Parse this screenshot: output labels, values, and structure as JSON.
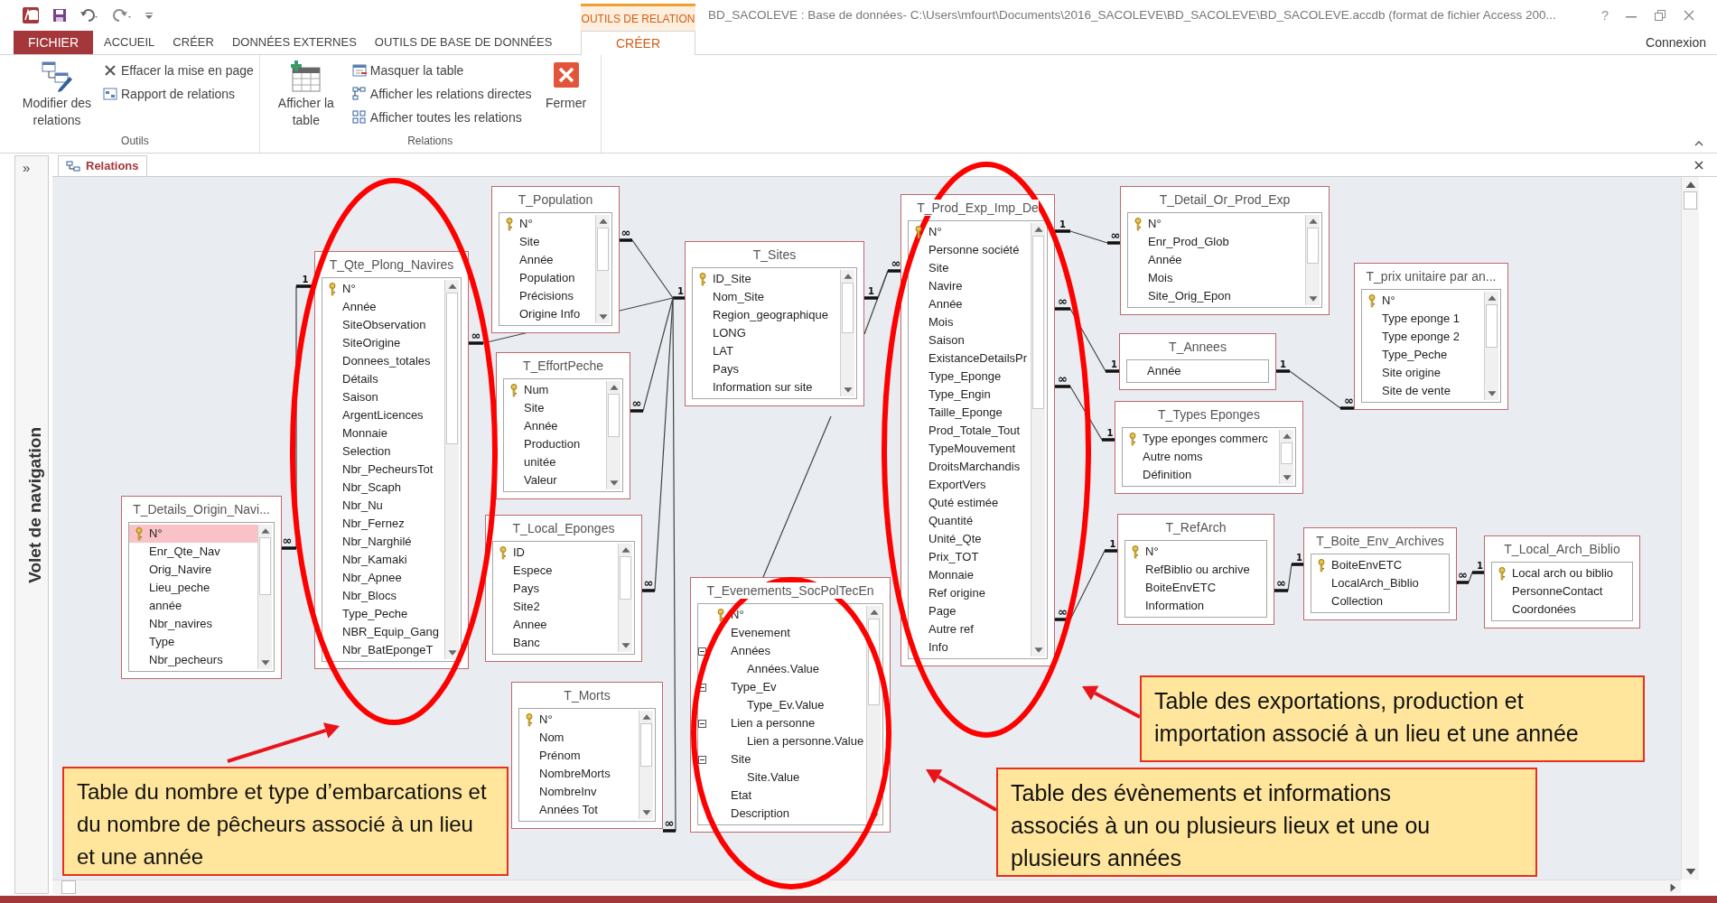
{
  "title_bar": {
    "contextual_group": "OUTILS DE RELATION",
    "title": "BD_SACOLEVE : Base de données- C:\\Users\\mfourt\\Documents\\2016_SACOLEVE\\BD_SACOLEVE\\BD_SACOLEVE.accdb (format de fichier Access 200...",
    "help": "?"
  },
  "ribbon_tabs": [
    {
      "label": "FICHIER",
      "kind": "file",
      "selected": false
    },
    {
      "label": "ACCUEIL",
      "kind": "normal",
      "selected": false
    },
    {
      "label": "CRÉER",
      "kind": "normal",
      "selected": false
    },
    {
      "label": "DONNÉES EXTERNES",
      "kind": "normal",
      "selected": false
    },
    {
      "label": "OUTILS DE BASE DE DONNÉES",
      "kind": "normal",
      "selected": false
    },
    {
      "label": "CRÉER",
      "kind": "contextual",
      "selected": true
    }
  ],
  "account": "Connexion",
  "ribbon_groups": [
    {
      "label": "Outils",
      "commands": [
        {
          "label": "Modifier des relations",
          "kind": "large"
        },
        {
          "label": "Effacer la mise en page",
          "kind": "small"
        },
        {
          "label": "Rapport de relations",
          "kind": "small"
        }
      ]
    },
    {
      "label": "Relations",
      "commands": [
        {
          "label": "Afficher la table",
          "kind": "large"
        },
        {
          "label": "Masquer la table",
          "kind": "small"
        },
        {
          "label": "Afficher les relations directes",
          "kind": "small"
        },
        {
          "label": "Afficher toutes les relations",
          "kind": "small"
        },
        {
          "label": "Fermer",
          "kind": "large"
        }
      ]
    }
  ],
  "navigation_pane": {
    "toggle": "»",
    "label": "Volet de navigation"
  },
  "document_tab": {
    "label": "Relations",
    "selected": true
  },
  "tables": [
    {
      "name": "T_Population",
      "scrollable": true,
      "fields": [
        {
          "label": "N°",
          "key": true,
          "selected": false
        },
        {
          "label": "Site",
          "key": false,
          "selected": false
        },
        {
          "label": "Année",
          "key": false,
          "selected": false
        },
        {
          "label": "Population",
          "key": false,
          "selected": false
        },
        {
          "label": "Précisions",
          "key": false,
          "selected": false
        },
        {
          "label": "Origine Info",
          "key": false,
          "selected": false
        }
      ]
    },
    {
      "name": "T_Qte_Plong_Navires",
      "scrollable": true,
      "fields": [
        {
          "label": "N°",
          "key": true,
          "selected": false
        },
        {
          "label": "Année",
          "key": false,
          "selected": false
        },
        {
          "label": "SiteObservation",
          "key": false,
          "selected": false
        },
        {
          "label": "SiteOrigine",
          "key": false,
          "selected": false
        },
        {
          "label": "Donnees_totales",
          "key": false,
          "selected": false
        },
        {
          "label": "Détails",
          "key": false,
          "selected": false
        },
        {
          "label": "Saison",
          "key": false,
          "selected": false
        },
        {
          "label": "ArgentLicences",
          "key": false,
          "selected": false
        },
        {
          "label": "Monnaie",
          "key": false,
          "selected": false
        },
        {
          "label": "Selection",
          "key": false,
          "selected": false
        },
        {
          "label": "Nbr_PecheursTot",
          "key": false,
          "selected": false
        },
        {
          "label": "Nbr_Scaph",
          "key": false,
          "selected": false
        },
        {
          "label": "Nbr_Nu",
          "key": false,
          "selected": false
        },
        {
          "label": "Nbr_Fernez",
          "key": false,
          "selected": false
        },
        {
          "label": "Nbr_Narghilé",
          "key": false,
          "selected": false
        },
        {
          "label": "Nbr_Kamaki",
          "key": false,
          "selected": false
        },
        {
          "label": "Nbr_Apnee",
          "key": false,
          "selected": false
        },
        {
          "label": "Nbr_Blocs",
          "key": false,
          "selected": false
        },
        {
          "label": "Type_Peche",
          "key": false,
          "selected": false
        },
        {
          "label": "NBR_Equip_Gang",
          "key": false,
          "selected": false
        },
        {
          "label": "Nbr_BatEpongeT",
          "key": false,
          "selected": false
        }
      ]
    },
    {
      "name": "T_EffortPeche",
      "scrollable": true,
      "fields": [
        {
          "label": "Num",
          "key": true,
          "selected": false
        },
        {
          "label": "Site",
          "key": false,
          "selected": false
        },
        {
          "label": "Année",
          "key": false,
          "selected": false
        },
        {
          "label": "Production",
          "key": false,
          "selected": false
        },
        {
          "label": "unitée",
          "key": false,
          "selected": false
        },
        {
          "label": "Valeur",
          "key": false,
          "selected": false
        }
      ]
    },
    {
      "name": "T_Details_Origin_Navi...",
      "scrollable": true,
      "fields": [
        {
          "label": "N°",
          "key": true,
          "selected": true
        },
        {
          "label": "Enr_Qte_Nav",
          "key": false,
          "selected": false
        },
        {
          "label": "Orig_Navire",
          "key": false,
          "selected": false
        },
        {
          "label": "Lieu_peche",
          "key": false,
          "selected": false
        },
        {
          "label": "année",
          "key": false,
          "selected": false
        },
        {
          "label": "Nbr_navires",
          "key": false,
          "selected": false
        },
        {
          "label": "Type",
          "key": false,
          "selected": false
        },
        {
          "label": "Nbr_pecheurs",
          "key": false,
          "selected": false
        }
      ]
    },
    {
      "name": "T_Local_Eponges",
      "scrollable": true,
      "fields": [
        {
          "label": "ID",
          "key": true,
          "selected": false
        },
        {
          "label": "Espece",
          "key": false,
          "selected": false
        },
        {
          "label": "Pays",
          "key": false,
          "selected": false
        },
        {
          "label": "Site2",
          "key": false,
          "selected": false
        },
        {
          "label": "Annee",
          "key": false,
          "selected": false
        },
        {
          "label": "Banc",
          "key": false,
          "selected": false
        }
      ]
    },
    {
      "name": "T_Morts",
      "scrollable": true,
      "fields": [
        {
          "label": "N°",
          "key": true,
          "selected": false
        },
        {
          "label": "Nom",
          "key": false,
          "selected": false
        },
        {
          "label": "Prénom",
          "key": false,
          "selected": false
        },
        {
          "label": "NombreMorts",
          "key": false,
          "selected": false
        },
        {
          "label": "NombreInv",
          "key": false,
          "selected": false
        },
        {
          "label": "Années Tot",
          "key": false,
          "selected": false
        }
      ]
    },
    {
      "name": "T_Sites",
      "scrollable": true,
      "fields": [
        {
          "label": "ID_Site",
          "key": true,
          "selected": false
        },
        {
          "label": "Nom_Site",
          "key": false,
          "selected": false
        },
        {
          "label": "Region_geographique",
          "key": false,
          "selected": false
        },
        {
          "label": "LONG",
          "key": false,
          "selected": false
        },
        {
          "label": "LAT",
          "key": false,
          "selected": false
        },
        {
          "label": "Pays",
          "key": false,
          "selected": false
        },
        {
          "label": "Information sur site",
          "key": false,
          "selected": false
        }
      ]
    },
    {
      "name": "T_Evenements_SocPolTecEn",
      "scrollable": true,
      "fields": [
        {
          "label": "N°",
          "key": true,
          "selected": false
        },
        {
          "label": "Evenement",
          "key": false,
          "selected": false
        },
        {
          "label": "Années",
          "key": false,
          "selected": false,
          "expanded": true,
          "children": [
            {
              "label": "Années.Value",
              "key": false,
              "selected": false
            }
          ]
        },
        {
          "label": "Type_Ev",
          "key": false,
          "selected": false,
          "expanded": true,
          "children": [
            {
              "label": "Type_Ev.Value",
              "key": false,
              "selected": false
            }
          ]
        },
        {
          "label": "Lien a personne",
          "key": false,
          "selected": false,
          "expanded": true,
          "children": [
            {
              "label": "Lien a personne.Value",
              "key": false,
              "selected": false
            }
          ]
        },
        {
          "label": "Site",
          "key": false,
          "selected": false,
          "expanded": true,
          "children": [
            {
              "label": "Site.Value",
              "key": false,
              "selected": false
            }
          ]
        },
        {
          "label": "Etat",
          "key": false,
          "selected": false
        },
        {
          "label": "Description",
          "key": false,
          "selected": false
        }
      ]
    },
    {
      "name": "T_Prod_Exp_Imp_De",
      "scrollable": true,
      "fields": [
        {
          "label": "N°",
          "key": true,
          "selected": false
        },
        {
          "label": "Personne société",
          "key": false,
          "selected": false
        },
        {
          "label": "Site",
          "key": false,
          "selected": false
        },
        {
          "label": "Navire",
          "key": false,
          "selected": false
        },
        {
          "label": "Année",
          "key": false,
          "selected": false
        },
        {
          "label": "Mois",
          "key": false,
          "selected": false
        },
        {
          "label": "Saison",
          "key": false,
          "selected": false
        },
        {
          "label": "ExistanceDetailsPr",
          "key": false,
          "selected": false
        },
        {
          "label": "Type_Eponge",
          "key": false,
          "selected": false
        },
        {
          "label": "Type_Engin",
          "key": false,
          "selected": false
        },
        {
          "label": "Taille_Eponge",
          "key": false,
          "selected": false
        },
        {
          "label": "Prod_Totale_Tout",
          "key": false,
          "selected": false
        },
        {
          "label": "TypeMouvement",
          "key": false,
          "selected": false
        },
        {
          "label": "DroitsMarchandis",
          "key": false,
          "selected": false
        },
        {
          "label": "ExportVers",
          "key": false,
          "selected": false
        },
        {
          "label": "Quté estimée",
          "key": false,
          "selected": false
        },
        {
          "label": "Quantité",
          "key": false,
          "selected": false
        },
        {
          "label": "Unité_Qte",
          "key": false,
          "selected": false
        },
        {
          "label": "Prix_TOT",
          "key": false,
          "selected": false
        },
        {
          "label": "Monnaie",
          "key": false,
          "selected": false
        },
        {
          "label": "Ref origine",
          "key": false,
          "selected": false
        },
        {
          "label": "Page",
          "key": false,
          "selected": false
        },
        {
          "label": "Autre ref",
          "key": false,
          "selected": false
        },
        {
          "label": "Info",
          "key": false,
          "selected": false
        }
      ]
    },
    {
      "name": "T_Detail_Or_Prod_Exp",
      "scrollable": true,
      "fields": [
        {
          "label": "N°",
          "key": true,
          "selected": false
        },
        {
          "label": "Enr_Prod_Glob",
          "key": false,
          "selected": false
        },
        {
          "label": "Année",
          "key": false,
          "selected": false
        },
        {
          "label": "Mois",
          "key": false,
          "selected": false
        },
        {
          "label": "Site_Orig_Epon",
          "key": false,
          "selected": false
        }
      ]
    },
    {
      "name": "T_Annees",
      "scrollable": false,
      "fields": [
        {
          "label": "Année",
          "key": false,
          "selected": false
        }
      ]
    },
    {
      "name": "T_Types Eponges",
      "scrollable": true,
      "fields": [
        {
          "label": "Type eponges commerc",
          "key": true,
          "selected": false
        },
        {
          "label": "Autre noms",
          "key": false,
          "selected": false
        },
        {
          "label": "Définition",
          "key": false,
          "selected": false
        }
      ]
    },
    {
      "name": "T_prix unitaire par an...",
      "scrollable": true,
      "fields": [
        {
          "label": "N°",
          "key": true,
          "selected": false
        },
        {
          "label": "Type eponge 1",
          "key": false,
          "selected": false
        },
        {
          "label": "Type eponge 2",
          "key": false,
          "selected": false
        },
        {
          "label": "Type_Peche",
          "key": false,
          "selected": false
        },
        {
          "label": "Site origine",
          "key": false,
          "selected": false
        },
        {
          "label": "Site de vente",
          "key": false,
          "selected": false
        }
      ]
    },
    {
      "name": "T_RefArch",
      "scrollable": false,
      "fields": [
        {
          "label": "N°",
          "key": true,
          "selected": false
        },
        {
          "label": "RefBiblio ou archive",
          "key": false,
          "selected": false
        },
        {
          "label": "BoiteEnvETC",
          "key": false,
          "selected": false
        },
        {
          "label": "Information",
          "key": false,
          "selected": false
        }
      ]
    },
    {
      "name": "T_Boite_Env_Archives",
      "scrollable": false,
      "fields": [
        {
          "label": "BoiteEnvETC",
          "key": true,
          "selected": false
        },
        {
          "label": "LocalArch_Biblio",
          "key": false,
          "selected": false
        },
        {
          "label": "Collection",
          "key": false,
          "selected": false
        }
      ]
    },
    {
      "name": "T_Local_Arch_Biblio",
      "scrollable": false,
      "fields": [
        {
          "label": "Local arch ou biblio",
          "key": true,
          "selected": false
        },
        {
          "label": "PersonneContact",
          "key": false,
          "selected": false
        },
        {
          "label": "Coordonées",
          "key": false,
          "selected": false
        }
      ]
    }
  ],
  "relationships": [
    {
      "ends": [
        "1",
        "∞"
      ]
    },
    {
      "ends": [
        "∞",
        "1"
      ]
    },
    {
      "ends": [
        "∞"
      ]
    },
    {
      "ends": [
        "∞"
      ]
    },
    {
      "ends": [
        "∞"
      ]
    },
    {
      "ends": [
        "∞"
      ]
    },
    {
      "ends": [
        "1",
        "∞"
      ]
    },
    {
      "ends": [
        "1",
        "∞"
      ]
    },
    {
      "ends": [
        "∞",
        "1"
      ]
    },
    {
      "ends": [
        "∞",
        "1"
      ]
    },
    {
      "ends": [
        "∞",
        "1"
      ]
    },
    {
      "ends": [
        "1",
        "∞"
      ]
    },
    {
      "ends": [
        "∞",
        "1"
      ]
    },
    {
      "ends": [
        "∞",
        "1"
      ]
    }
  ],
  "annotations": [
    {
      "text": "Table du nombre et type d’embarcations et du nombre de pêcheurs associé à un lieu et une année"
    },
    {
      "text": "Table des évènements et informations associés à un ou plusieurs lieux et une ou plusieurs années"
    },
    {
      "text": "Table des exportations, production et importation associé à un lieu et une année"
    }
  ]
}
